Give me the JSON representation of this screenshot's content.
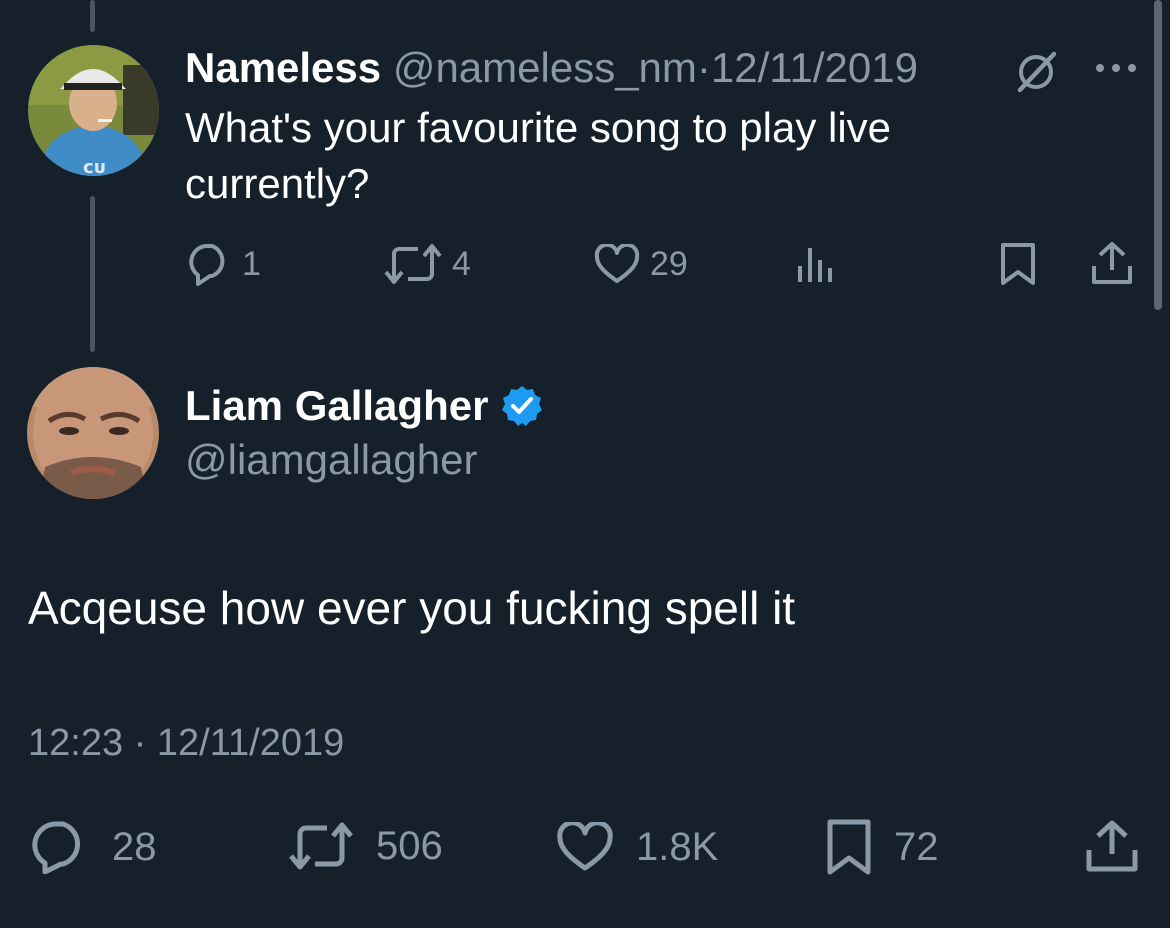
{
  "reply_tweet": {
    "display_name": "Nameless",
    "handle": "@nameless_nm",
    "separator": "·",
    "date": "12/11/2019",
    "text": "What's your favourite song to play live currently?",
    "replies": "1",
    "reposts": "4",
    "likes": "29",
    "icons": [
      "grok-icon",
      "more-icon",
      "reply-icon",
      "repost-icon",
      "like-icon",
      "views-icon",
      "bookmark-icon",
      "share-icon"
    ]
  },
  "main_tweet": {
    "display_name": "Liam Gallagher",
    "handle": "@liamgallagher",
    "text": "Acqeuse how ever you fucking spell it",
    "time": "12:23",
    "separator": "·",
    "date": "12/11/2019",
    "replies": "28",
    "reposts": "506",
    "likes": "1.8K",
    "bookmarks": "72",
    "icons": [
      "verified-badge-icon",
      "reply-icon",
      "repost-icon",
      "like-icon",
      "bookmark-icon",
      "share-icon"
    ]
  },
  "colors": {
    "background": "#15202b",
    "muted_text": "#8b98a5",
    "verified_badge": "#1d9bf0",
    "thread_line": "#4a5560"
  }
}
